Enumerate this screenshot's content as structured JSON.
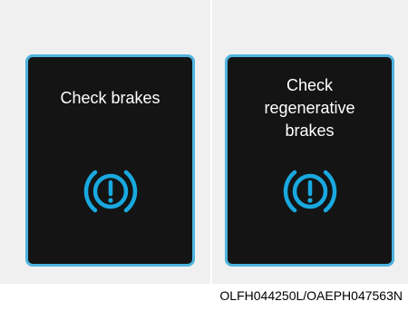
{
  "panels": [
    {
      "message_lines": [
        "Check brakes"
      ],
      "icon": "brake-warning-icon"
    },
    {
      "message_lines": [
        "Check",
        "regenerative",
        "brakes"
      ],
      "icon": "brake-warning-icon"
    }
  ],
  "caption": "OLFH044250L/OAEPH047563N",
  "colors": {
    "screen_background": "#141414",
    "screen_border": "#4fb3de",
    "icon_color": "#19a9e0",
    "text_color": "#ffffff",
    "page_background": "#f0f0f0"
  }
}
